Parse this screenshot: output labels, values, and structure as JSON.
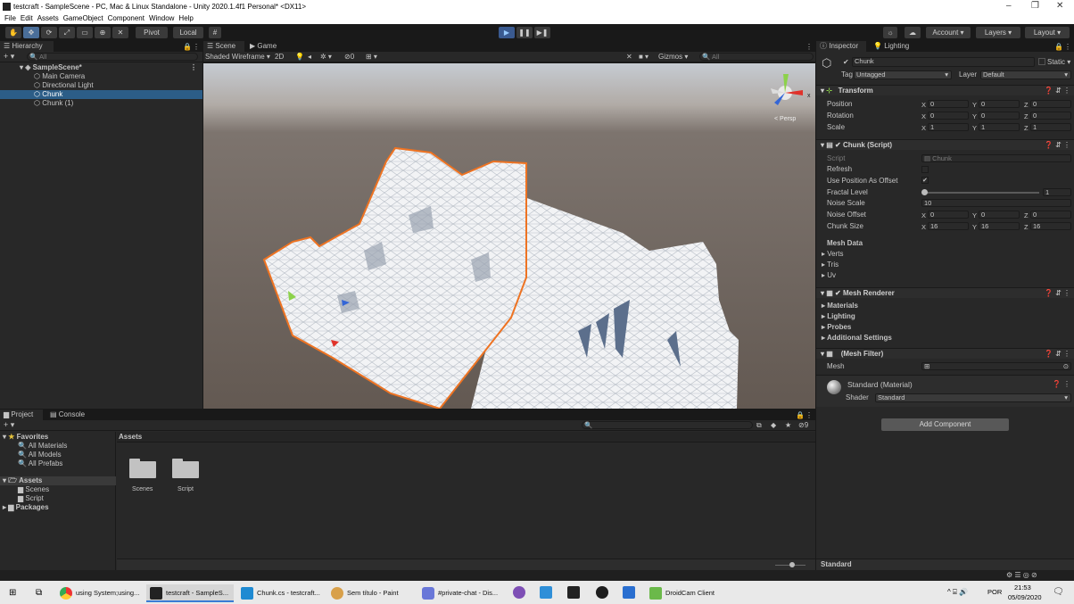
{
  "window": {
    "title": "testcraft - SampleScene - PC, Mac & Linux Standalone - Unity 2020.1.4f1 Personal* <DX11>"
  },
  "menu": [
    "File",
    "Edit",
    "Assets",
    "GameObject",
    "Component",
    "Window",
    "Help"
  ],
  "toolbar": {
    "pivot": "Pivot",
    "local": "Local",
    "account": "Account",
    "layers": "Layers",
    "layout": "Layout"
  },
  "hierarchy": {
    "tab": "Hierarchy",
    "search_placeholder": "All",
    "scene": "SampleScene*",
    "items": [
      "Main Camera",
      "Directional Light",
      "Chunk",
      "Chunk (1)"
    ]
  },
  "scene_view": {
    "tabs": [
      "Scene",
      "Game"
    ],
    "draw_mode": "Shaded Wireframe",
    "mode_2d": "2D",
    "fx_count": "0",
    "gizmos": "Gizmos",
    "search_placeholder": "All",
    "persp": "< Persp",
    "axis_x": "x"
  },
  "inspector": {
    "tabs": [
      "Inspector",
      "Lighting"
    ],
    "object_name": "Chunk",
    "static": "Static",
    "tag_label": "Tag",
    "tag_value": "Untagged",
    "layer_label": "Layer",
    "layer_value": "Default",
    "transform": {
      "title": "Transform",
      "rows": [
        {
          "label": "Position",
          "x": "0",
          "y": "0",
          "z": "0"
        },
        {
          "label": "Rotation",
          "x": "0",
          "y": "0",
          "z": "0"
        },
        {
          "label": "Scale",
          "x": "1",
          "y": "1",
          "z": "1"
        }
      ]
    },
    "chunk_script": {
      "title": "Chunk (Script)",
      "script_label": "Script",
      "script_value": "Chunk",
      "refresh": "Refresh",
      "use_position": "Use Position As Offset",
      "fractal_label": "Fractal Level",
      "fractal_value": "1",
      "noise_scale_label": "Noise Scale",
      "noise_scale_value": "10",
      "noise_offset": {
        "label": "Noise Offset",
        "x": "0",
        "y": "0",
        "z": "0"
      },
      "chunk_size": {
        "label": "Chunk Size",
        "x": "16",
        "y": "16",
        "z": "16"
      },
      "mesh_data": "Mesh Data",
      "mesh_items": [
        "Verts",
        "Tris",
        "Uv"
      ]
    },
    "mesh_renderer": {
      "title": "Mesh Renderer",
      "items": [
        "Materials",
        "Lighting",
        "Probes",
        "Additional Settings"
      ]
    },
    "mesh_filter": {
      "title": "(Mesh Filter)",
      "mesh_label": "Mesh"
    },
    "material": {
      "name": "Standard (Material)",
      "shader_label": "Shader",
      "shader_value": "Standard"
    },
    "add_component": "Add Component",
    "bottom_label": "Standard"
  },
  "project": {
    "tabs": [
      "Project",
      "Console"
    ],
    "favorites": "Favorites",
    "fav_items": [
      "All Materials",
      "All Models",
      "All Prefabs"
    ],
    "assets": "Assets",
    "asset_items": [
      "Scenes",
      "Script"
    ],
    "packages": "Packages",
    "breadcrumb": "Assets",
    "folders": [
      "Scenes",
      "Script"
    ],
    "hidden_count": "9"
  },
  "taskbar": {
    "items": [
      "using System;using...",
      "testcraft - SampleS...",
      "Chunk.cs - testcraft...",
      "Sem título - Paint",
      "#private-chat - Dis...",
      "DroidCam Client"
    ],
    "lang": "POR",
    "time": "21:53",
    "date": "05/09/2020"
  }
}
